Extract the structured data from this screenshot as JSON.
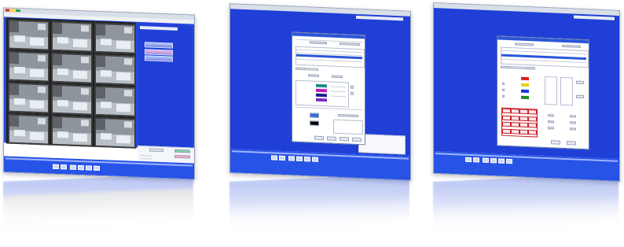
{
  "colors": {
    "workspace_blue": "#1f3fd6",
    "nav_bar_blue": "#2753e6",
    "window_chrome": "#d9dfe8",
    "red_grid": "#c8202a"
  },
  "screens": [
    {
      "name": "camera-grid-view",
      "camera_tiles": 12,
      "nav_buttons": 6
    },
    {
      "name": "color-settings-dialog",
      "nav_buttons": 6
    },
    {
      "name": "layout-settings-dialog",
      "nav_buttons": 6
    }
  ],
  "icons": [
    "camera-feed-icon",
    "nav-button-icon"
  ]
}
